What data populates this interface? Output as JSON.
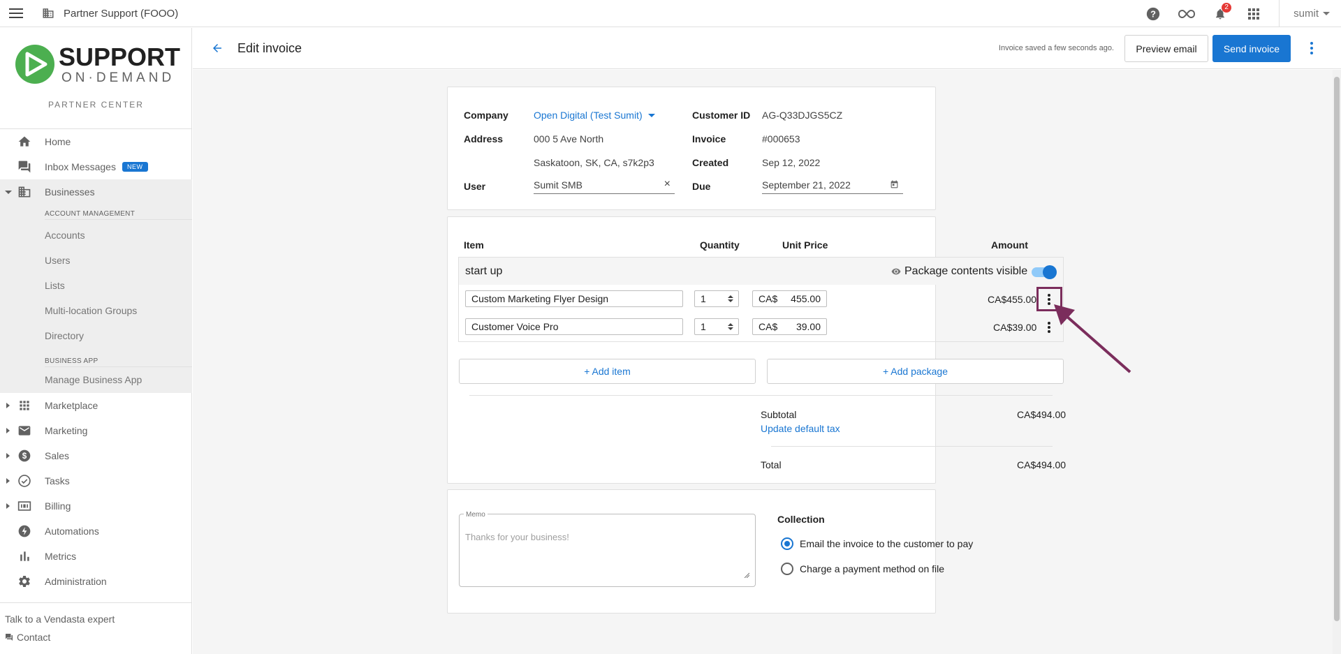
{
  "topbar": {
    "title": "Partner Support (FOOO)",
    "notification_count": "2",
    "user": "sumit"
  },
  "sidebar": {
    "logo_line1": "SUPPORT",
    "logo_line2": "ON·DEMAND",
    "partner_center": "PARTNER CENTER",
    "items": [
      {
        "label": "Home",
        "icon": "home-icon"
      },
      {
        "label": "Inbox Messages",
        "icon": "inbox-icon",
        "badge": "NEW"
      },
      {
        "label": "Businesses",
        "icon": "building-icon"
      },
      {
        "label": "Marketplace",
        "icon": "apps-icon"
      },
      {
        "label": "Marketing",
        "icon": "mail-icon"
      },
      {
        "label": "Sales",
        "icon": "dollar-icon"
      },
      {
        "label": "Tasks",
        "icon": "check-circle-icon"
      },
      {
        "label": "Billing",
        "icon": "billing-icon"
      },
      {
        "label": "Automations",
        "icon": "bolt-icon"
      },
      {
        "label": "Metrics",
        "icon": "bar-chart-icon"
      },
      {
        "label": "Administration",
        "icon": "gear-icon"
      }
    ],
    "account_management_header": "ACCOUNT MANAGEMENT",
    "account_items": [
      "Accounts",
      "Users",
      "Lists",
      "Multi-location Groups",
      "Directory"
    ],
    "business_app_header": "BUSINESS APP",
    "business_app_items": [
      "Manage Business App"
    ],
    "talk": "Talk to a Vendasta expert",
    "contact": "Contact"
  },
  "header": {
    "title": "Edit invoice",
    "saved_status": "Invoice saved a few seconds ago.",
    "preview_email": "Preview email",
    "send_invoice": "Send invoice"
  },
  "invoice": {
    "company_label": "Company",
    "company": "Open Digital (Test Sumit)",
    "address_label": "Address",
    "address_line1": "000 5 Ave North",
    "address_line2": "Saskatoon, SK, CA, s7k2p3",
    "user_label": "User",
    "user": "Sumit SMB",
    "customer_id_label": "Customer ID",
    "customer_id": "AG-Q33DJGS5CZ",
    "invoice_label": "Invoice",
    "invoice_number": "#000653",
    "created_label": "Created",
    "created": "Sep 12, 2022",
    "due_label": "Due",
    "due": "September 21, 2022"
  },
  "items_table": {
    "headers": {
      "item": "Item",
      "quantity": "Quantity",
      "unit_price": "Unit Price",
      "amount": "Amount"
    },
    "package": {
      "name": "start up",
      "visibility_label": "Package contents visible",
      "visible": true
    },
    "rows": [
      {
        "item": "Custom Marketing Flyer Design",
        "quantity": "1",
        "currency": "CA$",
        "unit_price": "455.00",
        "amount": "CA$455.00"
      },
      {
        "item": "Customer Voice Pro",
        "quantity": "1",
        "currency": "CA$",
        "unit_price": "39.00",
        "amount": "CA$39.00"
      }
    ],
    "add_item": "+ Add item",
    "add_package": "+ Add package",
    "subtotal_label": "Subtotal",
    "subtotal": "CA$494.00",
    "update_tax": "Update default tax",
    "total_label": "Total",
    "total": "CA$494.00"
  },
  "memo": {
    "label": "Memo",
    "placeholder": "Thanks for your business!"
  },
  "collection": {
    "title": "Collection",
    "options": [
      {
        "label": "Email the invoice to the customer to pay",
        "selected": true
      },
      {
        "label": "Charge a payment method on file",
        "selected": false
      }
    ]
  },
  "colors": {
    "primary": "#1976d2",
    "annotation": "#7b2d5c"
  }
}
